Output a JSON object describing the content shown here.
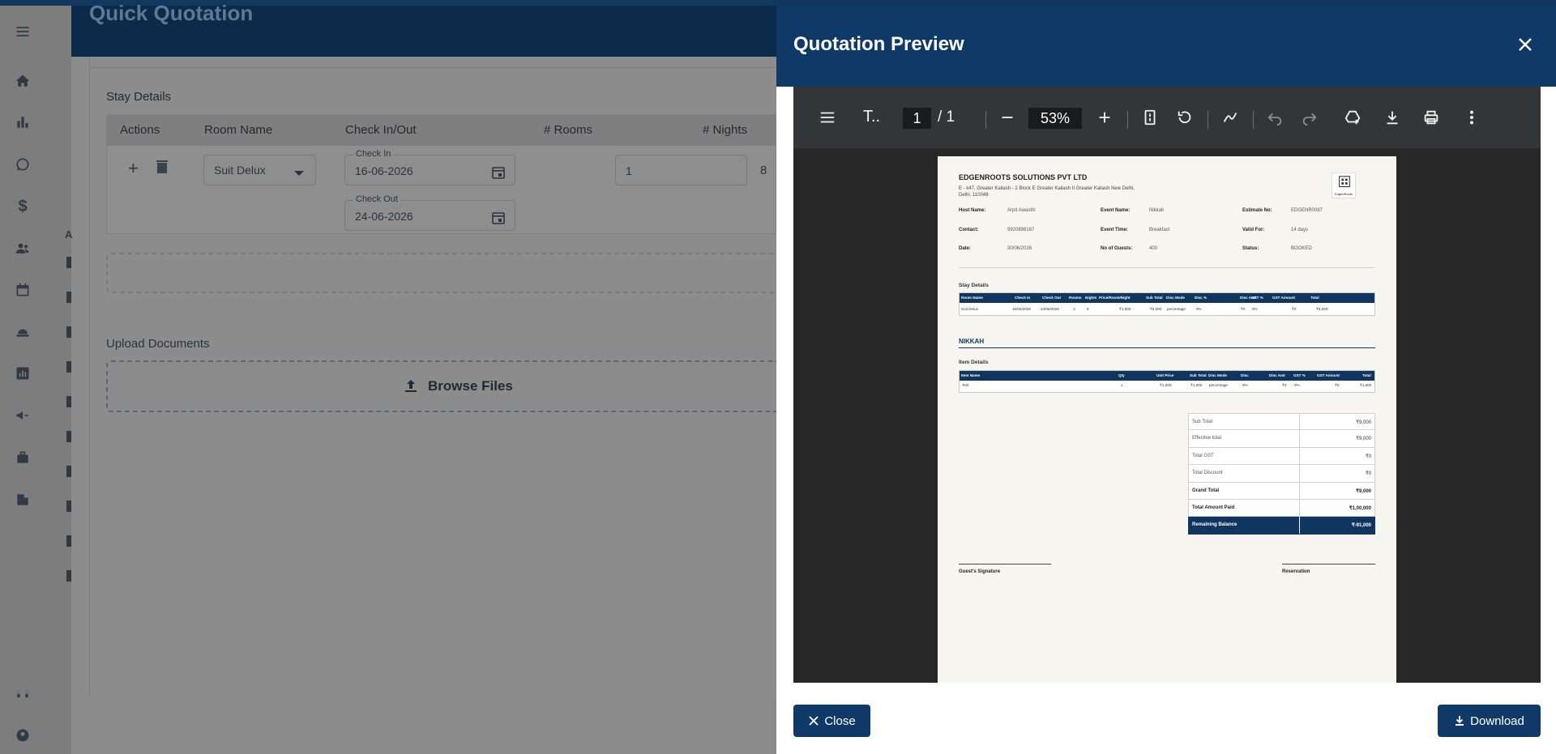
{
  "background": {
    "title": "Quick Quotation",
    "stay_details_label": "Stay Details",
    "columns": [
      "Actions",
      "Room Name",
      "Check In/Out",
      "# Rooms",
      "# Nights"
    ],
    "row": {
      "room_name": "Suit Delux",
      "check_in_label": "Check In",
      "check_in": "16-06-2026",
      "check_out_label": "Check Out",
      "check_out": "24-06-2026",
      "rooms": "1",
      "nights": "8"
    },
    "upload_label": "Upload Documents",
    "browse_label": "Browse Files",
    "side_letter": "A"
  },
  "dialog": {
    "title": "Quotation Preview",
    "close_label": "Close",
    "download_label": "Download"
  },
  "viewer": {
    "doc_title": "T..",
    "page_current": "1",
    "page_total": "/  1",
    "zoom": "53%"
  },
  "pdf": {
    "company": "EDGENROOTS SOLUTIONS PVT LTD",
    "address": "E - k47, Greater Kailash - 2 Block E Greater Kailash II Greater Kailash New Delhi, Delhi, 110048",
    "logo_text": "EdgenRoots",
    "fields": {
      "host_name_label": "Host Name:",
      "host_name": "Arpit Awasthi",
      "event_name_label": "Event Name:",
      "event_name": "Nikkah",
      "estimate_label": "Estimate No:",
      "estimate": "EDGENR0097",
      "contact_label": "Contact:",
      "contact": "9920898167",
      "event_time_label": "Event Time:",
      "event_time": "Breakfast",
      "valid_for_label": "Valid For:",
      "valid_for": "14 days",
      "date_label": "Date:",
      "date": "30/06/2026",
      "guests_label": "No of Guests:",
      "guests": "400",
      "status_label": "Status:",
      "status": "BOOKED"
    },
    "stay_title": "Stay Details",
    "stay_headers": [
      "Room Name",
      "Check In",
      "Check Out",
      "Rooms",
      "Nights",
      "Price/Room/Night",
      "Sub Total",
      "Disc Mode",
      "Disc %",
      "Disc Amt",
      "GST %",
      "GST Amount",
      "Total"
    ],
    "stay_row": [
      "Suit Delux",
      "16/06/2026",
      "24/06/2026",
      "1",
      "8",
      "₹1,000",
      "₹8,000",
      "percentage",
      "0%",
      "₹0",
      "0%",
      "₹0",
      "₹8,000"
    ],
    "section_event": "NIKKAH",
    "item_title": "Item Details",
    "item_headers": [
      "Item Name",
      "Qty",
      "Unit Price",
      "Sub Total",
      "Disc Mode",
      "Disc",
      "Disc Amt",
      "GST %",
      "GST Amount",
      "Total"
    ],
    "item_row": [
      "Test",
      "1",
      "₹1,000",
      "₹1,000",
      "percentage",
      "0%",
      "₹0",
      "0%",
      "₹0",
      "₹1,000"
    ],
    "summary": [
      {
        "label": "Sub Total",
        "value": "₹9,000"
      },
      {
        "label": "Effective total",
        "value": "₹9,000"
      },
      {
        "label": "Total GST",
        "value": "₹0"
      },
      {
        "label": "Total Discount",
        "value": "₹0"
      },
      {
        "label": "Grand Total",
        "value": "₹9,000"
      },
      {
        "label": "Total Amount Paid",
        "value": "₹1,00,000"
      },
      {
        "label": "Remaining Balance",
        "value": "₹-91,000"
      }
    ],
    "sig_left": "Guest's Signature",
    "sig_right": "Reservation"
  }
}
